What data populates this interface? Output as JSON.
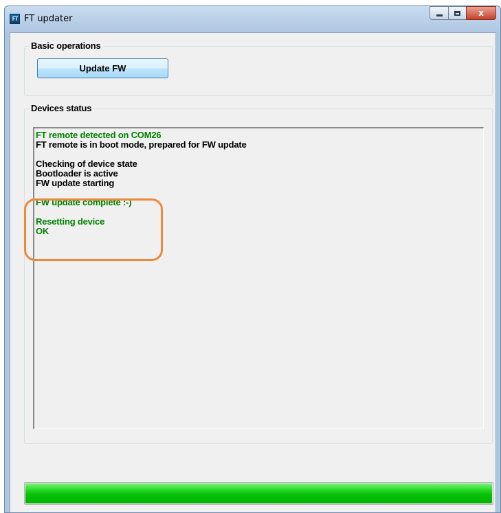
{
  "window": {
    "title": "FT updater",
    "icon_text": "FT",
    "close_glyph": "x"
  },
  "basic_operations": {
    "label": "Basic operations",
    "update_button": "Update FW"
  },
  "devices_status": {
    "label": "Devices status",
    "log": [
      {
        "text": "FT remote detected on COM26",
        "color": "green"
      },
      {
        "text": "FT remote is in boot mode, prepared for FW update",
        "color": "black"
      },
      {
        "text": "",
        "color": "black"
      },
      {
        "text": "Checking of device state",
        "color": "black"
      },
      {
        "text": "Bootloader is active",
        "color": "black"
      },
      {
        "text": "FW update starting",
        "color": "black"
      },
      {
        "text": "",
        "color": "black"
      },
      {
        "text": "FW update complete :-)",
        "color": "green"
      },
      {
        "text": "",
        "color": "black"
      },
      {
        "text": "Resetting device",
        "color": "green"
      },
      {
        "text": "OK",
        "color": "green"
      }
    ]
  },
  "progress": {
    "value": 1.0
  },
  "colors": {
    "log_green": "#008000",
    "highlight": "#f0883a",
    "progress": "#06c106"
  }
}
